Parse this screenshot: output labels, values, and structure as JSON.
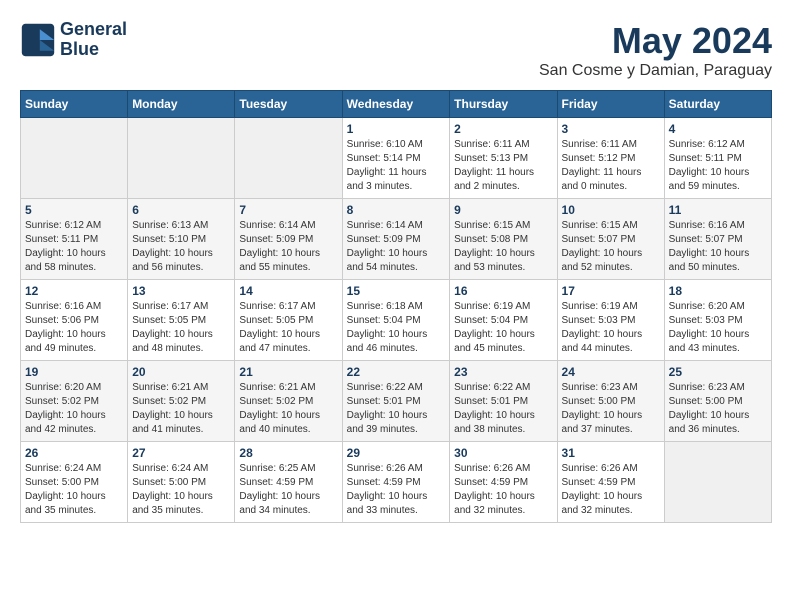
{
  "header": {
    "logo_line1": "General",
    "logo_line2": "Blue",
    "month": "May 2024",
    "location": "San Cosme y Damian, Paraguay"
  },
  "days_of_week": [
    "Sunday",
    "Monday",
    "Tuesday",
    "Wednesday",
    "Thursday",
    "Friday",
    "Saturday"
  ],
  "weeks": [
    [
      {
        "day": "",
        "info": ""
      },
      {
        "day": "",
        "info": ""
      },
      {
        "day": "",
        "info": ""
      },
      {
        "day": "1",
        "info": "Sunrise: 6:10 AM\nSunset: 5:14 PM\nDaylight: 11 hours and 3 minutes."
      },
      {
        "day": "2",
        "info": "Sunrise: 6:11 AM\nSunset: 5:13 PM\nDaylight: 11 hours and 2 minutes."
      },
      {
        "day": "3",
        "info": "Sunrise: 6:11 AM\nSunset: 5:12 PM\nDaylight: 11 hours and 0 minutes."
      },
      {
        "day": "4",
        "info": "Sunrise: 6:12 AM\nSunset: 5:11 PM\nDaylight: 10 hours and 59 minutes."
      }
    ],
    [
      {
        "day": "5",
        "info": "Sunrise: 6:12 AM\nSunset: 5:11 PM\nDaylight: 10 hours and 58 minutes."
      },
      {
        "day": "6",
        "info": "Sunrise: 6:13 AM\nSunset: 5:10 PM\nDaylight: 10 hours and 56 minutes."
      },
      {
        "day": "7",
        "info": "Sunrise: 6:14 AM\nSunset: 5:09 PM\nDaylight: 10 hours and 55 minutes."
      },
      {
        "day": "8",
        "info": "Sunrise: 6:14 AM\nSunset: 5:09 PM\nDaylight: 10 hours and 54 minutes."
      },
      {
        "day": "9",
        "info": "Sunrise: 6:15 AM\nSunset: 5:08 PM\nDaylight: 10 hours and 53 minutes."
      },
      {
        "day": "10",
        "info": "Sunrise: 6:15 AM\nSunset: 5:07 PM\nDaylight: 10 hours and 52 minutes."
      },
      {
        "day": "11",
        "info": "Sunrise: 6:16 AM\nSunset: 5:07 PM\nDaylight: 10 hours and 50 minutes."
      }
    ],
    [
      {
        "day": "12",
        "info": "Sunrise: 6:16 AM\nSunset: 5:06 PM\nDaylight: 10 hours and 49 minutes."
      },
      {
        "day": "13",
        "info": "Sunrise: 6:17 AM\nSunset: 5:05 PM\nDaylight: 10 hours and 48 minutes."
      },
      {
        "day": "14",
        "info": "Sunrise: 6:17 AM\nSunset: 5:05 PM\nDaylight: 10 hours and 47 minutes."
      },
      {
        "day": "15",
        "info": "Sunrise: 6:18 AM\nSunset: 5:04 PM\nDaylight: 10 hours and 46 minutes."
      },
      {
        "day": "16",
        "info": "Sunrise: 6:19 AM\nSunset: 5:04 PM\nDaylight: 10 hours and 45 minutes."
      },
      {
        "day": "17",
        "info": "Sunrise: 6:19 AM\nSunset: 5:03 PM\nDaylight: 10 hours and 44 minutes."
      },
      {
        "day": "18",
        "info": "Sunrise: 6:20 AM\nSunset: 5:03 PM\nDaylight: 10 hours and 43 minutes."
      }
    ],
    [
      {
        "day": "19",
        "info": "Sunrise: 6:20 AM\nSunset: 5:02 PM\nDaylight: 10 hours and 42 minutes."
      },
      {
        "day": "20",
        "info": "Sunrise: 6:21 AM\nSunset: 5:02 PM\nDaylight: 10 hours and 41 minutes."
      },
      {
        "day": "21",
        "info": "Sunrise: 6:21 AM\nSunset: 5:02 PM\nDaylight: 10 hours and 40 minutes."
      },
      {
        "day": "22",
        "info": "Sunrise: 6:22 AM\nSunset: 5:01 PM\nDaylight: 10 hours and 39 minutes."
      },
      {
        "day": "23",
        "info": "Sunrise: 6:22 AM\nSunset: 5:01 PM\nDaylight: 10 hours and 38 minutes."
      },
      {
        "day": "24",
        "info": "Sunrise: 6:23 AM\nSunset: 5:00 PM\nDaylight: 10 hours and 37 minutes."
      },
      {
        "day": "25",
        "info": "Sunrise: 6:23 AM\nSunset: 5:00 PM\nDaylight: 10 hours and 36 minutes."
      }
    ],
    [
      {
        "day": "26",
        "info": "Sunrise: 6:24 AM\nSunset: 5:00 PM\nDaylight: 10 hours and 35 minutes."
      },
      {
        "day": "27",
        "info": "Sunrise: 6:24 AM\nSunset: 5:00 PM\nDaylight: 10 hours and 35 minutes."
      },
      {
        "day": "28",
        "info": "Sunrise: 6:25 AM\nSunset: 4:59 PM\nDaylight: 10 hours and 34 minutes."
      },
      {
        "day": "29",
        "info": "Sunrise: 6:26 AM\nSunset: 4:59 PM\nDaylight: 10 hours and 33 minutes."
      },
      {
        "day": "30",
        "info": "Sunrise: 6:26 AM\nSunset: 4:59 PM\nDaylight: 10 hours and 32 minutes."
      },
      {
        "day": "31",
        "info": "Sunrise: 6:26 AM\nSunset: 4:59 PM\nDaylight: 10 hours and 32 minutes."
      },
      {
        "day": "",
        "info": ""
      }
    ]
  ]
}
